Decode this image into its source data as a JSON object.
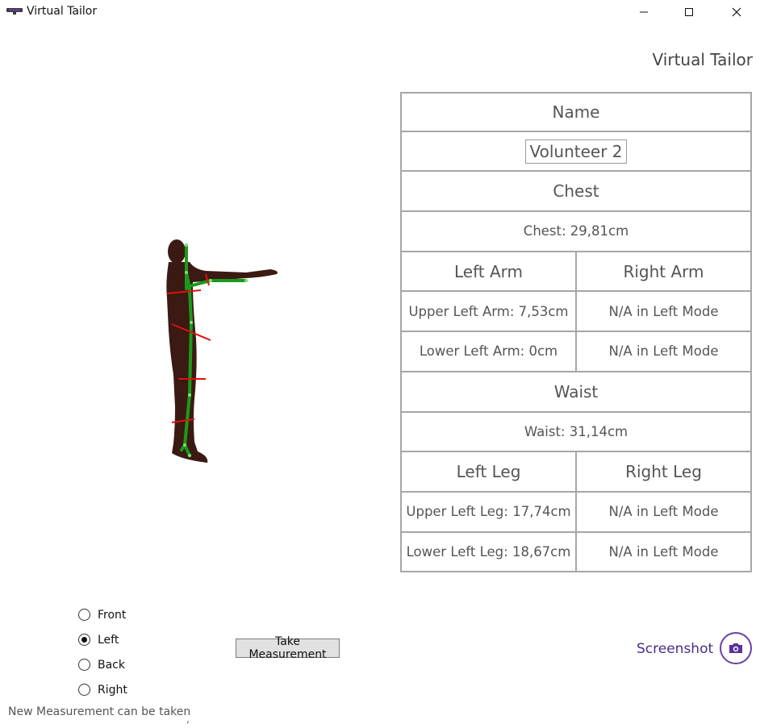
{
  "window": {
    "title": "Virtual Tailor"
  },
  "header": {
    "title": "Virtual Tailor"
  },
  "table": {
    "name_header": "Name",
    "name_value": "Volunteer 2",
    "chest_header": "Chest",
    "chest_value": "Chest: 29,81cm",
    "left_arm_header": "Left Arm",
    "right_arm_header": "Right Arm",
    "upper_left_arm": "Upper Left Arm: 7,53cm",
    "upper_right_arm": "N/A in Left Mode",
    "lower_left_arm": "Lower Left Arm: 0cm",
    "lower_right_arm": "N/A in Left Mode",
    "waist_header": "Waist",
    "waist_value": "Waist: 31,14cm",
    "left_leg_header": "Left Leg",
    "right_leg_header": "Right Leg",
    "upper_left_leg": "Upper Left Leg: 17,74cm",
    "upper_right_leg": "N/A in Left Mode",
    "lower_left_leg": "Lower Left Leg: 18,67cm",
    "lower_right_leg": "N/A in Left Mode"
  },
  "modes": [
    {
      "label": "Front",
      "selected": false
    },
    {
      "label": "Left",
      "selected": true
    },
    {
      "label": "Back",
      "selected": false
    },
    {
      "label": "Right",
      "selected": false
    }
  ],
  "take_button": "Take Measurement",
  "screenshot_label": "Screenshot",
  "status": "New Measurement can be taken",
  "status_mark": ",",
  "colors": {
    "accent": "#6b3fa8",
    "skeleton": "#1a9a1a",
    "measure_line": "#e01010",
    "silhouette": "#3a1a12"
  },
  "icons": {
    "camera": "camera-icon",
    "app": "app-icon"
  }
}
